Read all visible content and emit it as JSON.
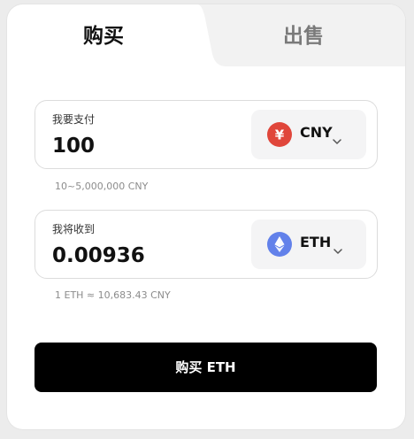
{
  "tabs": {
    "buy": "购买",
    "sell": "出售",
    "active": "buy"
  },
  "pay": {
    "label": "我要支付",
    "amount": "100",
    "currency": "CNY",
    "currency_symbol": "¥",
    "range_hint": "10~5,000,000 CNY"
  },
  "receive": {
    "label": "我将收到",
    "amount": "0.00936",
    "currency": "ETH",
    "rate_hint": "1 ETH ≈ 10,683.43 CNY"
  },
  "submit": {
    "label": "购买 ETH"
  },
  "colors": {
    "cny_icon": "#e0463b",
    "eth_icon": "#6281ea",
    "submit_bg": "#000000",
    "inactive_tab_bg": "#f2f2f2"
  },
  "icons": {
    "cny": "yuan-coin-icon",
    "eth": "ethereum-icon",
    "dropdown": "chevron-down-icon"
  }
}
